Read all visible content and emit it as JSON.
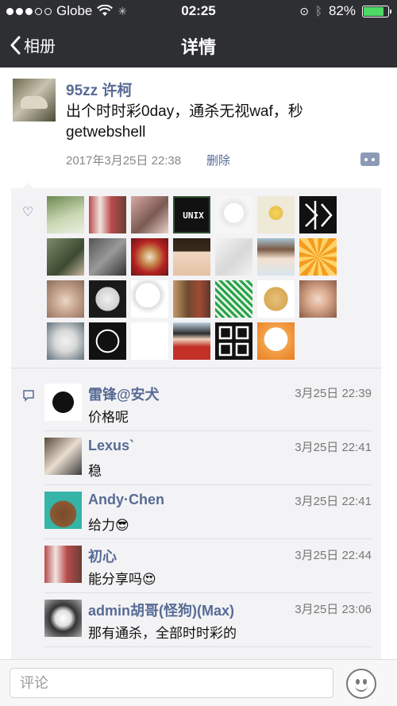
{
  "status_bar": {
    "carrier": "Globe",
    "time": "02:25",
    "battery": "82%"
  },
  "nav": {
    "back_label": "相册",
    "title": "详情"
  },
  "post": {
    "author": "95zz 许柯",
    "text": "出个时时彩0day，通杀无视waf，秒getwebshell",
    "timestamp": "2017年3月25日 22:38",
    "delete_label": "删除"
  },
  "likes_icon": "heart-icon",
  "liked_count_visible": 27,
  "comments": [
    {
      "name": "雷锋@安犬",
      "time": "3月25日 22:39",
      "text": "价格呢"
    },
    {
      "name": "Lexus`",
      "time": "3月25日 22:41",
      "text": "稳"
    },
    {
      "name": "Andy·Chen",
      "time": "3月25日 22:41",
      "text": "给力😎"
    },
    {
      "name": "初心",
      "time": "3月25日 22:44",
      "text": "能分享吗😍"
    },
    {
      "name": "admin胡哥(怪狗)(Max)",
      "time": "3月25日 23:06",
      "text": "那有通杀，全部时时彩的"
    }
  ],
  "unix_avatar_text": "UNIX",
  "input": {
    "placeholder": "评论"
  },
  "colors": {
    "link": "#576b95",
    "nav_bg": "#2e2f33",
    "panel_bg": "#f3f3f5"
  }
}
